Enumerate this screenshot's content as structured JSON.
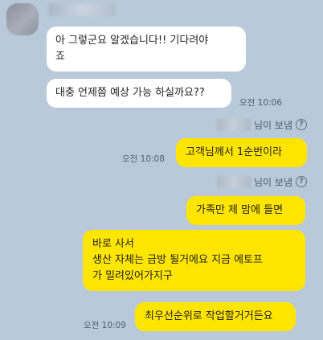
{
  "messages": {
    "in1": "아 그렇군요 알겠습니다!! 기다려야\n죠",
    "in2": "대충 언제쯤 예상 가능 하실까요??",
    "in2_time": "오전 10:06",
    "reader_suffix": "님이 보냄",
    "out1": "고객님께서 1순번이라",
    "out1_time": "오전 10:08",
    "out2": "가족만 제 맘에 들면",
    "out3": "바로 사서\n생산 자체는 금방 될거에요 지금 에토프\n가 밀려있어가지구",
    "out4": "최우선순위로 작업할거거든요",
    "out4_time": "오전 10:09"
  },
  "icons": {
    "help": "question-circle-icon"
  },
  "colors": {
    "background": "#b9c9d9",
    "incoming_bubble": "#ffffff",
    "outgoing_bubble": "#fee500"
  }
}
